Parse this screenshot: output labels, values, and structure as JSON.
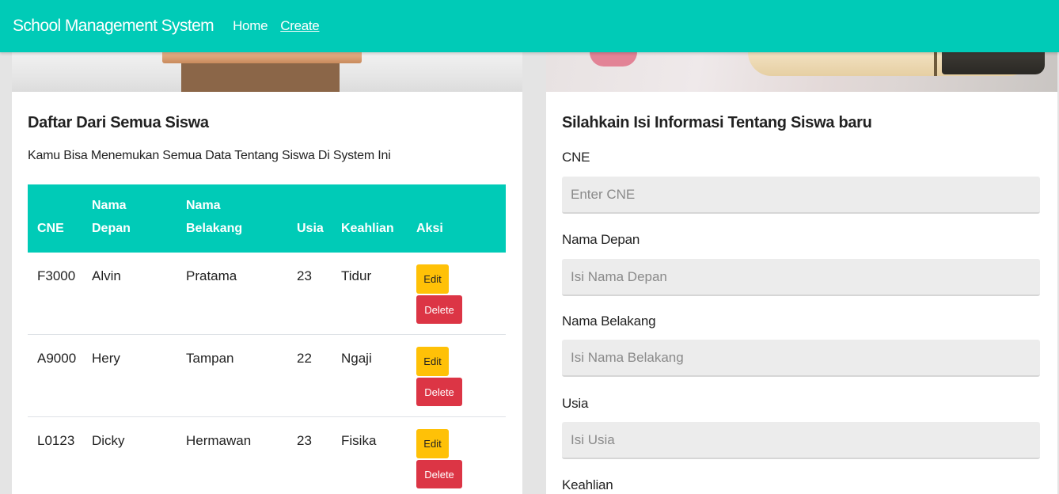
{
  "navbar": {
    "brand": "School Management System",
    "links": [
      {
        "label": "Home",
        "active": false
      },
      {
        "label": "Create",
        "active": true
      }
    ],
    "color": "#00cbb7"
  },
  "list_card": {
    "title": "Daftar Dari Semua Siswa",
    "subtitle": "Kamu Bisa Menemukan Semua Data Tentang Siswa Di System Ini",
    "table": {
      "headers": [
        "CNE",
        "Nama Depan",
        "Nama Belakang",
        "Usia",
        "Keahlian",
        "Aksi"
      ],
      "rows": [
        {
          "cne": "F3000",
          "nama_depan": "Alvin",
          "nama_belakang": "Pratama",
          "usia": "23",
          "keahlian": "Tidur"
        },
        {
          "cne": "A9000",
          "nama_depan": "Hery",
          "nama_belakang": "Tampan",
          "usia": "22",
          "keahlian": "Ngaji"
        },
        {
          "cne": "L0123",
          "nama_depan": "Dicky",
          "nama_belakang": "Hermawan",
          "usia": "23",
          "keahlian": "Fisika"
        }
      ],
      "edit_label": "Edit",
      "delete_label": "Delete"
    }
  },
  "form_card": {
    "title": "Silahkain Isi Informasi Tentang Siswa baru",
    "fields": [
      {
        "label": "CNE",
        "placeholder": "Enter CNE",
        "value": ""
      },
      {
        "label": "Nama Depan",
        "placeholder": "Isi Nama Depan",
        "value": ""
      },
      {
        "label": "Nama Belakang",
        "placeholder": "Isi Nama Belakang",
        "value": ""
      },
      {
        "label": "Usia",
        "placeholder": "Isi Usia",
        "value": ""
      },
      {
        "label": "Keahlian",
        "placeholder": "",
        "value": ""
      }
    ]
  },
  "colors": {
    "accent": "#00cbb7",
    "edit": "#ffc107",
    "delete": "#dc3545"
  }
}
